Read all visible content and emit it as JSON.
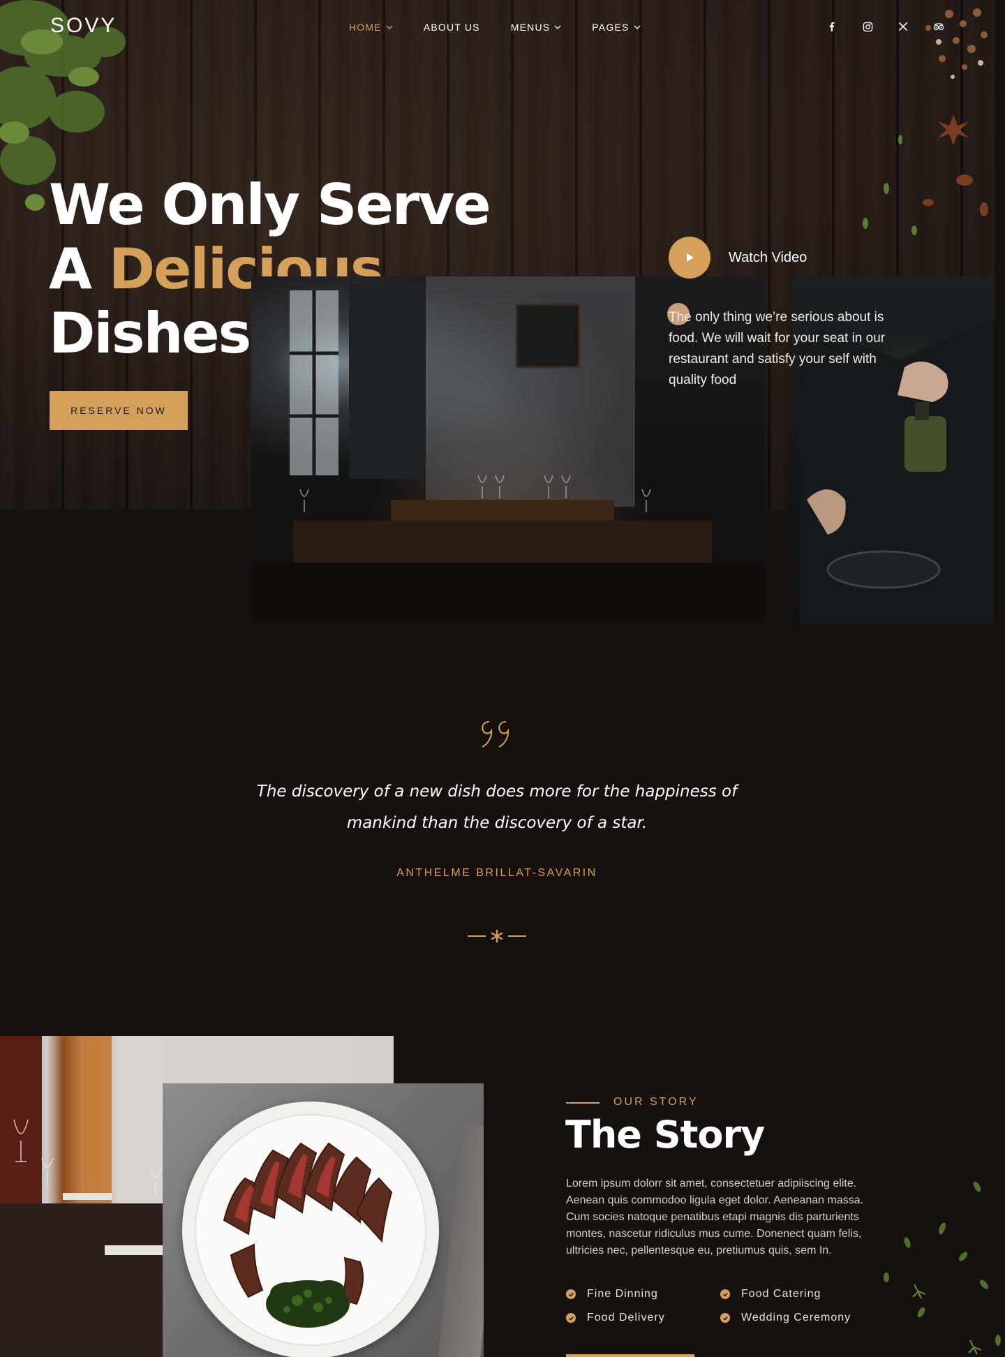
{
  "brand": {
    "logo": "SOVY",
    "accent_color": "#d4a05a"
  },
  "nav": {
    "items": [
      {
        "label": "HOME",
        "active": true,
        "has_dropdown": true
      },
      {
        "label": "ABOUT US",
        "active": false,
        "has_dropdown": false
      },
      {
        "label": "MENUS",
        "active": false,
        "has_dropdown": true
      },
      {
        "label": "PAGES",
        "active": false,
        "has_dropdown": true
      }
    ],
    "social": [
      "facebook-icon",
      "instagram-icon",
      "x-icon",
      "tripadvisor-icon"
    ]
  },
  "hero": {
    "title_line1": "We Only Serve",
    "title_line2_prefix": "A ",
    "title_line2_accent": "Delicious",
    "title_line3": "Dishes",
    "cta_label": "RESERVE NOW",
    "watch_video_label": "Watch Video",
    "description": "The only thing we’re serious about is food. We will wait for your seat in our restaurant and satisfy your self with quality food"
  },
  "quote": {
    "text": "The discovery of a new dish does more for the happiness of mankind than the discovery of a star.",
    "author": "ANTHELME BRILLAT-SAVARIN"
  },
  "story": {
    "eyebrow": "OUR STORY",
    "title": "The Story",
    "body": "Lorem ipsum dolorr sit amet, consectetuer adipiiscing elite. Aenean quis commodoo ligula eget dolor. Aeneanan massa. Cum socies natoque penatibus etapi magnis dis parturients montes, nascetur ridiculus mus cume. Donenect quam felis, ultricies nec, pellentesque eu, pretiumus quis, sem In.",
    "features": [
      "Fine Dinning",
      "Food Catering",
      "Food Delivery",
      "Wedding Ceremony"
    ]
  }
}
